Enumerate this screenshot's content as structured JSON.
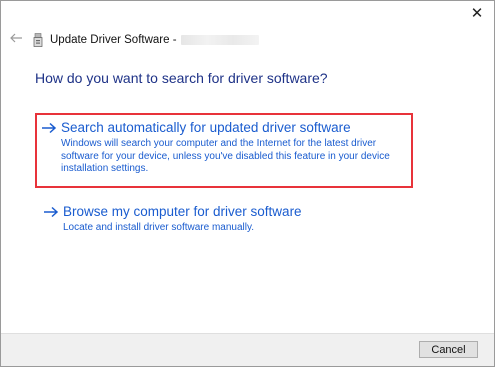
{
  "window": {
    "title": "Update Driver Software -",
    "close_glyph": "✕"
  },
  "heading": "How do you want to search for driver software?",
  "options": [
    {
      "title": "Search automatically for updated driver software",
      "description": "Windows will search your computer and the Internet for the latest driver software for your device, unless you've disabled this feature in your device installation settings."
    },
    {
      "title": "Browse my computer for driver software",
      "description": "Locate and install driver software manually."
    }
  ],
  "footer": {
    "cancel_label": "Cancel"
  },
  "colors": {
    "heading": "#1e3287",
    "link": "#1a5ccf",
    "highlight_border": "#e8333a",
    "footer_bg": "#f0f0f0"
  },
  "icons": [
    "close-icon",
    "back-arrow-icon",
    "device-icon",
    "arrow-right-icon"
  ]
}
